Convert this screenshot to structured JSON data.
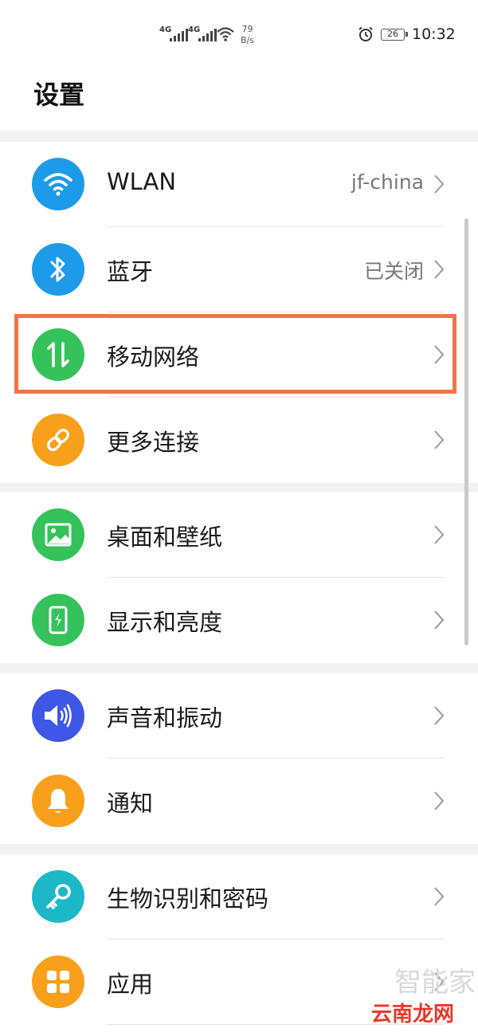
{
  "status_bar": {
    "net1": "4G",
    "net2": "4G",
    "speed_value": "79",
    "speed_unit": "B/s",
    "battery": "26",
    "time": "10:32"
  },
  "header": {
    "title": "设置"
  },
  "groups": [
    {
      "items": [
        {
          "label": "WLAN",
          "value": "jf-china",
          "icon": "wifi-icon",
          "color": "#1e9be8"
        },
        {
          "label": "蓝牙",
          "value": "已关闭",
          "icon": "bluetooth-icon",
          "color": "#1e9be8"
        },
        {
          "label": "移动网络",
          "value": "",
          "icon": "mobile-data-icon",
          "color": "#35c25b"
        },
        {
          "label": "更多连接",
          "value": "",
          "icon": "link-icon",
          "color": "#f8a01c"
        }
      ]
    },
    {
      "items": [
        {
          "label": "桌面和壁纸",
          "icon": "wallpaper-icon",
          "color": "#35c25b"
        },
        {
          "label": "显示和亮度",
          "icon": "display-icon",
          "color": "#35c25b"
        }
      ]
    },
    {
      "items": [
        {
          "label": "声音和振动",
          "icon": "sound-icon",
          "color": "#3f57e6"
        },
        {
          "label": "通知",
          "icon": "bell-icon",
          "color": "#f8a01c"
        }
      ]
    },
    {
      "items": [
        {
          "label": "生物识别和密码",
          "icon": "key-icon",
          "color": "#1cb8c8"
        },
        {
          "label": "应用",
          "icon": "apps-icon",
          "color": "#f8a01c"
        }
      ]
    }
  ],
  "watermark": {
    "text": "云南龙网",
    "faint": "智能家"
  }
}
